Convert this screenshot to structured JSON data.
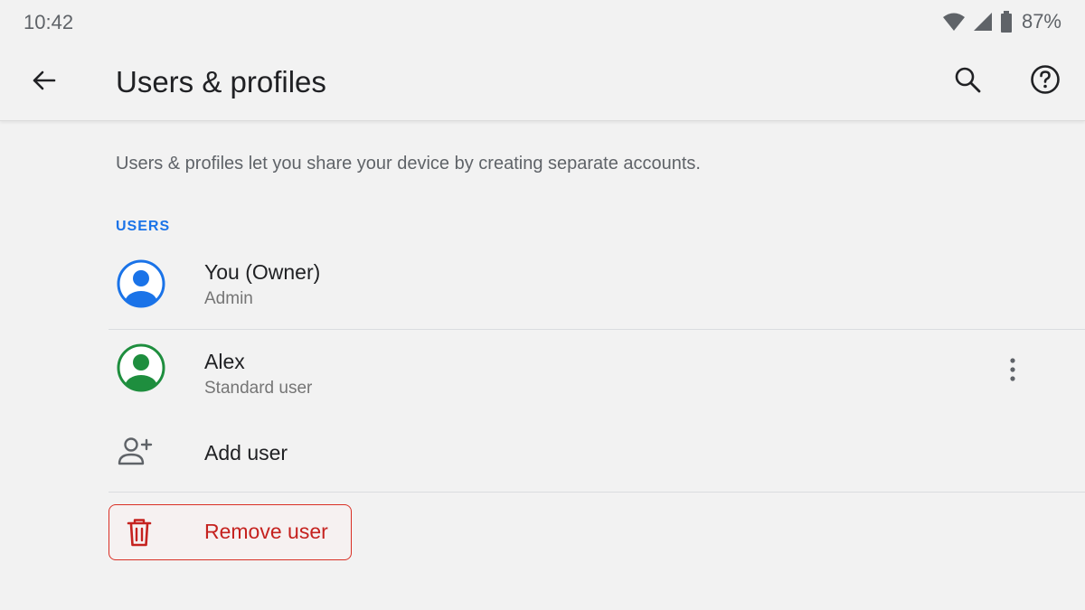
{
  "status_bar": {
    "time": "10:42",
    "battery_percent": "87%",
    "icons": [
      "wifi-icon",
      "cell-signal-icon",
      "battery-icon"
    ]
  },
  "app_bar": {
    "title": "Users & profiles",
    "back_icon": "arrow-left-icon",
    "search_icon": "search-icon",
    "help_icon": "help-icon"
  },
  "content": {
    "description": "Users & profiles let you share your device by creating separate accounts.",
    "section_header": "USERS",
    "users": [
      {
        "name": "You (Owner)",
        "role": "Admin",
        "avatar_color": "#1a73e8"
      },
      {
        "name": "Alex",
        "role": "Standard user",
        "avatar_color": "#1e8e3e",
        "menu_icon": "more-vertical-icon"
      }
    ],
    "add_user": {
      "label": "Add user",
      "icon": "person-add-icon"
    },
    "remove_user": {
      "label": "Remove user",
      "icon": "trash-icon"
    }
  },
  "colors": {
    "background": "#f2f2f2",
    "accent_blue": "#1a73e8",
    "accent_green": "#1e8e3e",
    "danger_red": "#d93025",
    "text_secondary": "#5f6368"
  }
}
